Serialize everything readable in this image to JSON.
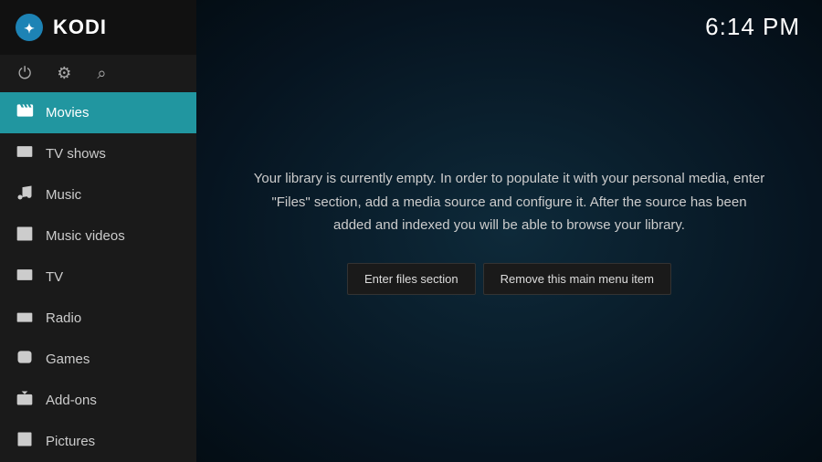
{
  "app": {
    "title": "KODI"
  },
  "time": "6:14 PM",
  "toolbar": {
    "power_icon": "⏻",
    "settings_icon": "⚙",
    "search_icon": "🔍"
  },
  "nav": {
    "items": [
      {
        "id": "movies",
        "label": "Movies",
        "active": true
      },
      {
        "id": "tv-shows",
        "label": "TV shows",
        "active": false
      },
      {
        "id": "music",
        "label": "Music",
        "active": false
      },
      {
        "id": "music-videos",
        "label": "Music videos",
        "active": false
      },
      {
        "id": "tv",
        "label": "TV",
        "active": false
      },
      {
        "id": "radio",
        "label": "Radio",
        "active": false
      },
      {
        "id": "games",
        "label": "Games",
        "active": false
      },
      {
        "id": "add-ons",
        "label": "Add-ons",
        "active": false
      },
      {
        "id": "pictures",
        "label": "Pictures",
        "active": false
      }
    ]
  },
  "main": {
    "message": "Your library is currently empty. In order to populate it with your personal media, enter \"Files\" section, add a media source and configure it. After the source has been added and indexed you will be able to browse your library.",
    "btn_files": "Enter files section",
    "btn_remove": "Remove this main menu item"
  }
}
